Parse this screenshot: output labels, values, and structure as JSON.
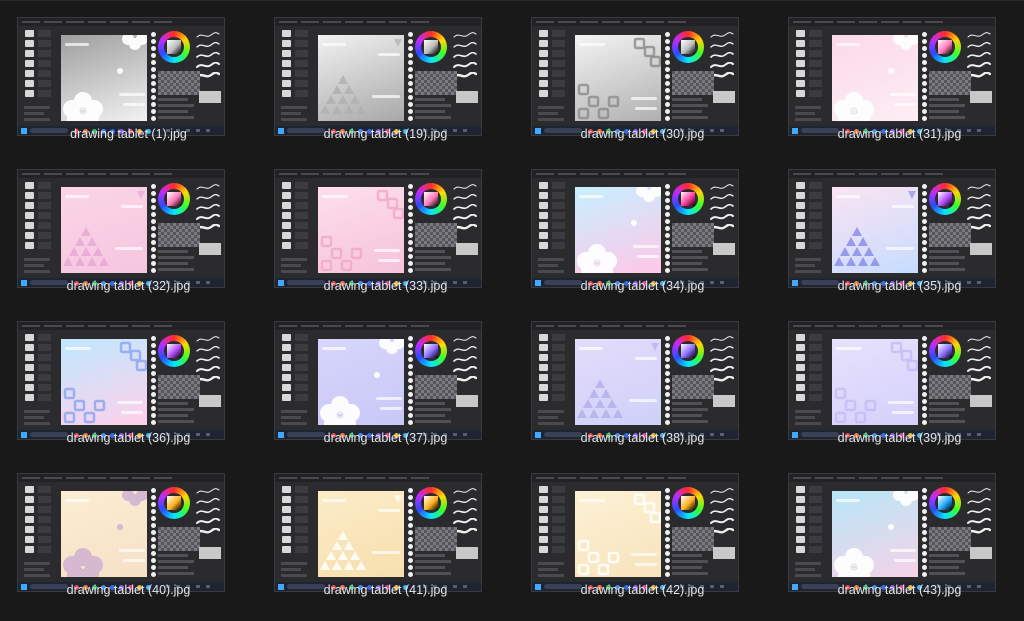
{
  "files": [
    {
      "name": "drawing tablet (1).jpg",
      "bg": [
        "#9e9e9e",
        "#f2f2f2"
      ],
      "motif": "flower",
      "accent": "#ffffff"
    },
    {
      "name": "drawing tablet (19).jpg",
      "bg": [
        "#f2f2f2",
        "#a8a8a8"
      ],
      "motif": "triangles",
      "accent": "#b0b0b0"
    },
    {
      "name": "drawing tablet (30).jpg",
      "bg": [
        "#f4f4f4",
        "#b0b0b0"
      ],
      "motif": "squares",
      "accent": "#8e8e8e"
    },
    {
      "name": "drawing tablet (31).jpg",
      "bg": [
        "#fbd9e9",
        "#fdeef4"
      ],
      "motif": "flower",
      "accent": "#ffffff"
    },
    {
      "name": "drawing tablet (32).jpg",
      "bg": [
        "#fbd5e6",
        "#f5c6e0"
      ],
      "motif": "triangles",
      "accent": "#e8a8d6"
    },
    {
      "name": "drawing tablet (33).jpg",
      "bg": [
        "#fde0ec",
        "#f6c2da"
      ],
      "motif": "squares",
      "accent": "#f0a9cc"
    },
    {
      "name": "drawing tablet (34).jpg",
      "bg": [
        "#c7f0ff",
        "#ffc7e8"
      ],
      "motif": "flower",
      "accent": "#ffffff"
    },
    {
      "name": "drawing tablet (35).jpg",
      "bg": [
        "#fbe4f2",
        "#c7dcff"
      ],
      "motif": "triangles",
      "accent": "#8a8ee8"
    },
    {
      "name": "drawing tablet (36).jpg",
      "bg": [
        "#bfe8ff",
        "#ffd0ea"
      ],
      "motif": "squares",
      "accent": "#8da7f0"
    },
    {
      "name": "drawing tablet (37).jpg",
      "bg": [
        "#d7d6fb",
        "#c9c7f7"
      ],
      "motif": "flower",
      "accent": "#ffffff"
    },
    {
      "name": "drawing tablet (38).jpg",
      "bg": [
        "#e4dcfb",
        "#cfd0f8"
      ],
      "motif": "triangles",
      "accent": "#b3b0ea"
    },
    {
      "name": "drawing tablet (39).jpg",
      "bg": [
        "#e8e2fd",
        "#d4d0fb"
      ],
      "motif": "squares",
      "accent": "#c4bdf5"
    },
    {
      "name": "drawing tablet (40).jpg",
      "bg": [
        "#fbeed2",
        "#f6e0c8"
      ],
      "motif": "flower",
      "accent": "#d6b6d2"
    },
    {
      "name": "drawing tablet (41).jpg",
      "bg": [
        "#fbecc8",
        "#f7dfae"
      ],
      "motif": "triangles",
      "accent": "#ffffff"
    },
    {
      "name": "drawing tablet (42).jpg",
      "bg": [
        "#fdf1d6",
        "#f7e3bb"
      ],
      "motif": "squares",
      "accent": "#ffffff"
    },
    {
      "name": "drawing tablet (43).jpg",
      "bg": [
        "#b6e7f7",
        "#f6d2e8"
      ],
      "motif": "flower",
      "accent": "#ffffff"
    }
  ],
  "wheel_squares": [
    "#bcbcbc",
    "#bcbcbc",
    "#bcbcbc",
    "#ff7ab8",
    "#ff7ab8",
    "#ff7ab8",
    "#ff3aa0",
    "#b44aff",
    "#b44aff",
    "#8a6cff",
    "#8a6cff",
    "#8a6cff",
    "#ffb020",
    "#ffb020",
    "#ffb020",
    "#1ea7ff"
  ]
}
